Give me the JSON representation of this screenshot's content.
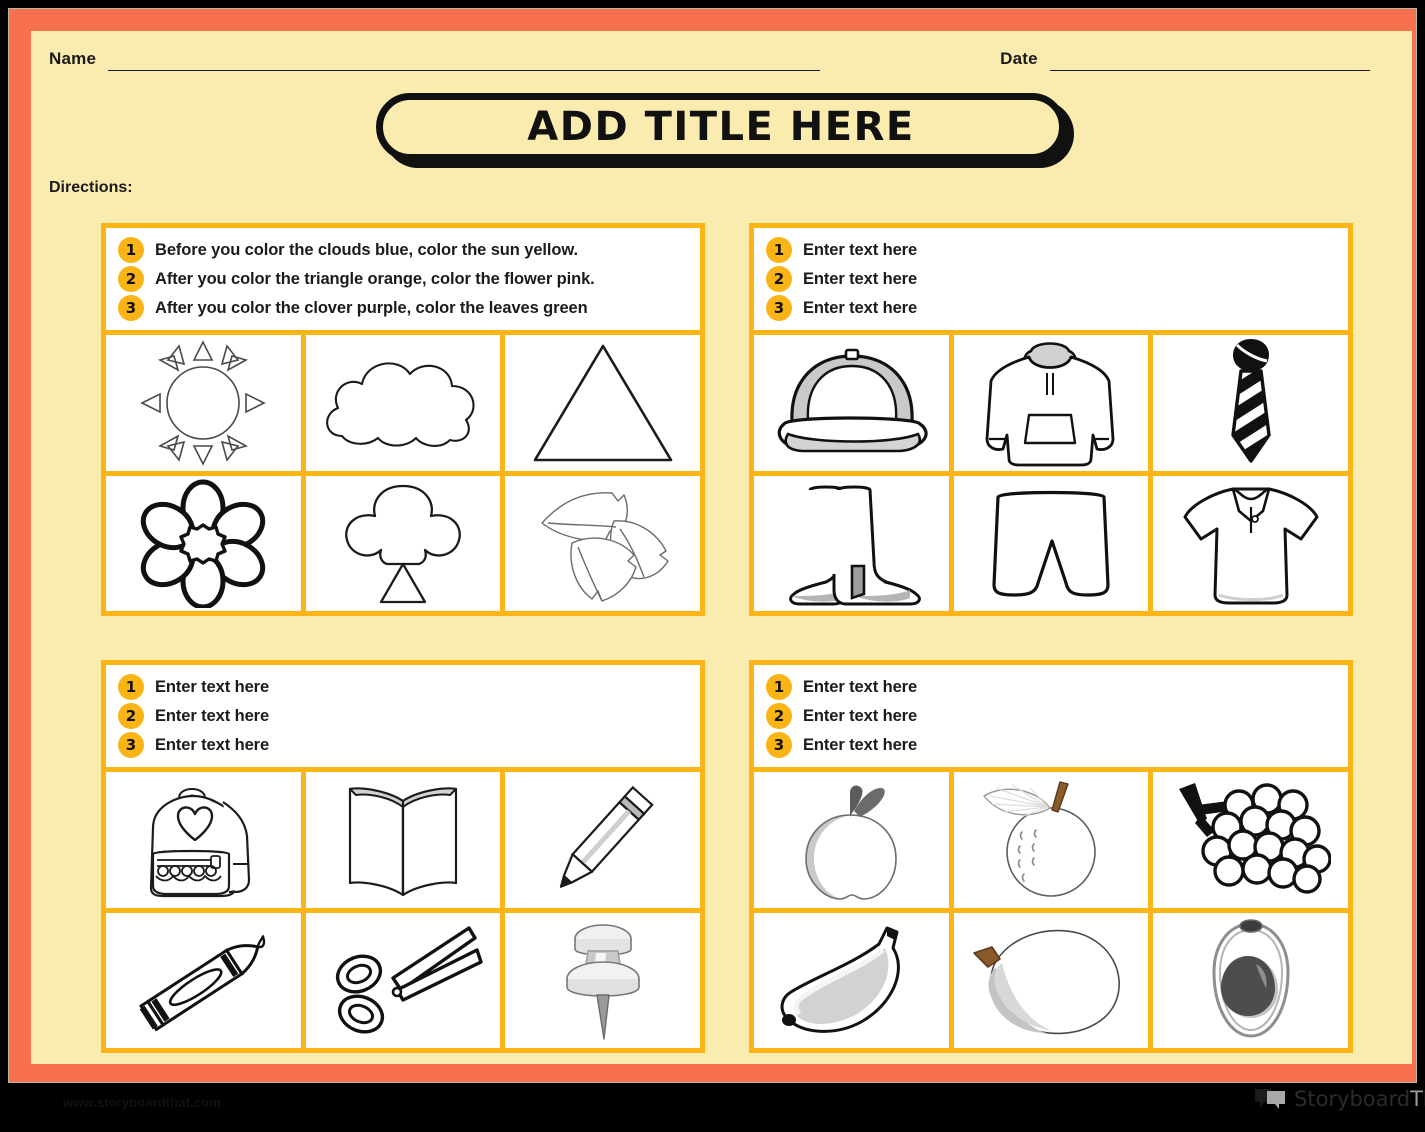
{
  "page": {
    "frame_color": "#F8714F",
    "paper_color": "#FAEBAF",
    "accent_color": "#FBB415"
  },
  "header": {
    "name_label": "Name",
    "date_label": "Date"
  },
  "title": {
    "text": "ADD TITLE HERE"
  },
  "directions_label": "Directions:",
  "panels": [
    {
      "id": "panel-shapes-nature",
      "instructions": [
        {
          "num": "1",
          "text": "Before you color the clouds blue, color the sun yellow."
        },
        {
          "num": "2",
          "text": "After you color the triangle orange, color the flower pink."
        },
        {
          "num": "3",
          "text": "After you color the clover purple, color the leaves green"
        }
      ],
      "images": [
        {
          "name": "sun-image",
          "label": "sun"
        },
        {
          "name": "cloud-image",
          "label": "cloud"
        },
        {
          "name": "triangle-image",
          "label": "triangle"
        },
        {
          "name": "flower-image",
          "label": "flower"
        },
        {
          "name": "clover-image",
          "label": "clover"
        },
        {
          "name": "leaves-image",
          "label": "leaves"
        }
      ]
    },
    {
      "id": "panel-clothing",
      "instructions": [
        {
          "num": "1",
          "text": "Enter text here"
        },
        {
          "num": "2",
          "text": "Enter text here"
        },
        {
          "num": "3",
          "text": "Enter text here"
        }
      ],
      "images": [
        {
          "name": "cap-image",
          "label": "baseball cap"
        },
        {
          "name": "hoodie-image",
          "label": "hoodie"
        },
        {
          "name": "necktie-image",
          "label": "necktie"
        },
        {
          "name": "boots-image",
          "label": "boots"
        },
        {
          "name": "shorts-image",
          "label": "shorts"
        },
        {
          "name": "polo-shirt-image",
          "label": "polo shirt"
        }
      ]
    },
    {
      "id": "panel-school-supplies",
      "instructions": [
        {
          "num": "1",
          "text": "Enter text here"
        },
        {
          "num": "2",
          "text": "Enter text here"
        },
        {
          "num": "3",
          "text": "Enter text here"
        }
      ],
      "images": [
        {
          "name": "backpack-image",
          "label": "backpack"
        },
        {
          "name": "book-image",
          "label": "book"
        },
        {
          "name": "pencil-image",
          "label": "pencil"
        },
        {
          "name": "crayon-image",
          "label": "crayon"
        },
        {
          "name": "scissors-image",
          "label": "scissors"
        },
        {
          "name": "push-pin-image",
          "label": "push pin"
        }
      ]
    },
    {
      "id": "panel-fruits",
      "instructions": [
        {
          "num": "1",
          "text": "Enter text here"
        },
        {
          "num": "2",
          "text": "Enter text here"
        },
        {
          "num": "3",
          "text": "Enter text here"
        }
      ],
      "images": [
        {
          "name": "apple-image",
          "label": "apple"
        },
        {
          "name": "orange-image",
          "label": "orange"
        },
        {
          "name": "grapes-image",
          "label": "grapes"
        },
        {
          "name": "banana-image",
          "label": "banana"
        },
        {
          "name": "mango-image",
          "label": "mango"
        },
        {
          "name": "avocado-image",
          "label": "avocado"
        }
      ]
    }
  ],
  "footer": {
    "url": "www.storyboardthat.com",
    "logo_primary": "Storyboard",
    "logo_secondary": "That"
  }
}
